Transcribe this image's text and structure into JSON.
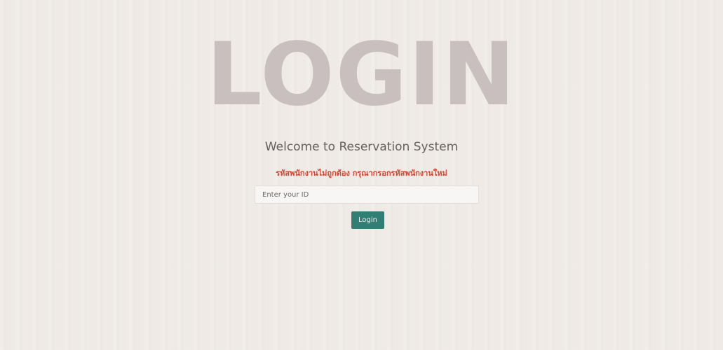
{
  "hero": {
    "title": "LOGIN"
  },
  "form": {
    "welcome_text": "Welcome to Reservation System",
    "error_message": "รหัสพนักงานไม่ถูกต้อง กรุณากรอกรหัสพนักงานใหม่",
    "id_input": {
      "value": "",
      "placeholder": "Enter your ID"
    },
    "login_button_label": "Login"
  },
  "colors": {
    "background": "#efebe7",
    "hero_text": "#c8bfbe",
    "error_text": "#d9432f",
    "button": "#2f7f74"
  }
}
